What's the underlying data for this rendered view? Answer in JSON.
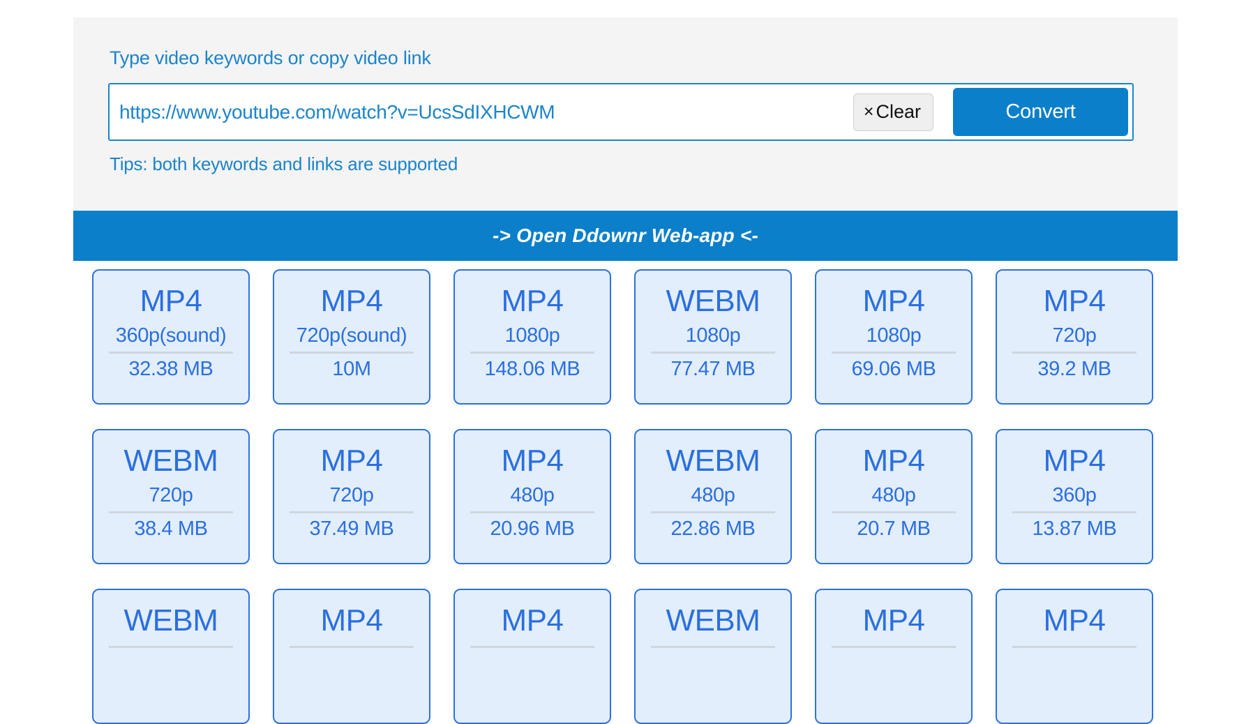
{
  "search": {
    "label": "Type video keywords or copy video link",
    "input_value": "https://www.youtube.com/watch?v=UcsSdIXHCWM",
    "input_placeholder": "Type video keywords or copy video link",
    "clear_label": "Clear",
    "clear_icon": "×",
    "convert_label": "Convert",
    "tips": "Tips: both keywords and links are supported"
  },
  "promo": {
    "text": "-> Open Ddownr Web-app <-"
  },
  "colors": {
    "accent_blue": "#0b7fca",
    "label_blue": "#1b84ca",
    "card_text_blue": "#2b6fe0",
    "card_bg": "#e2eefc",
    "card_border": "#2b72e0",
    "panel_bg": "#f4f4f4",
    "clear_bg": "#efefef"
  },
  "formats": [
    {
      "format": "MP4",
      "quality": "360p(sound)",
      "size": "32.38 MB"
    },
    {
      "format": "MP4",
      "quality": "720p(sound)",
      "size": "10M"
    },
    {
      "format": "MP4",
      "quality": "1080p",
      "size": "148.06 MB"
    },
    {
      "format": "WEBM",
      "quality": "1080p",
      "size": "77.47 MB"
    },
    {
      "format": "MP4",
      "quality": "1080p",
      "size": "69.06 MB"
    },
    {
      "format": "MP4",
      "quality": "720p",
      "size": "39.2 MB"
    },
    {
      "format": "WEBM",
      "quality": "720p",
      "size": "38.4 MB"
    },
    {
      "format": "MP4",
      "quality": "720p",
      "size": "37.49 MB"
    },
    {
      "format": "MP4",
      "quality": "480p",
      "size": "20.96 MB"
    },
    {
      "format": "WEBM",
      "quality": "480p",
      "size": "22.86 MB"
    },
    {
      "format": "MP4",
      "quality": "480p",
      "size": "20.7 MB"
    },
    {
      "format": "MP4",
      "quality": "360p",
      "size": "13.87 MB"
    },
    {
      "format": "WEBM",
      "quality": "",
      "size": ""
    },
    {
      "format": "MP4",
      "quality": "",
      "size": ""
    },
    {
      "format": "MP4",
      "quality": "",
      "size": ""
    },
    {
      "format": "WEBM",
      "quality": "",
      "size": ""
    },
    {
      "format": "MP4",
      "quality": "",
      "size": ""
    },
    {
      "format": "MP4",
      "quality": "",
      "size": ""
    }
  ]
}
